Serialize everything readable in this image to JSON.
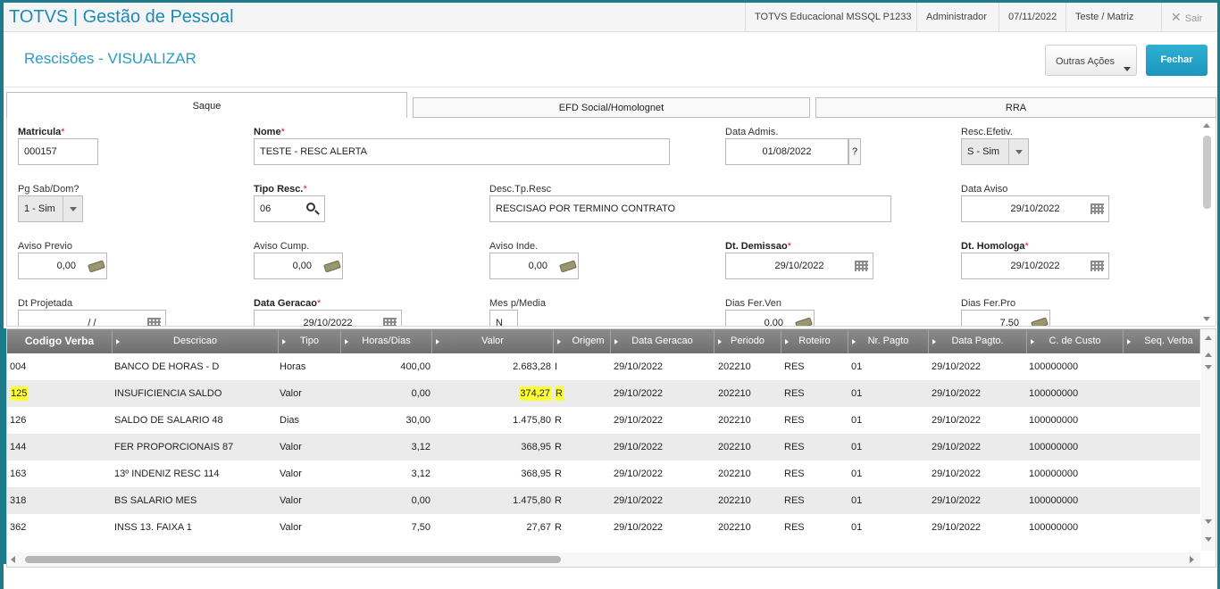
{
  "topbar": {
    "app_title": "TOTVS | Gestão de Pessoal",
    "environment": "TOTVS Educacional MSSQL P1233",
    "user": "Administrador",
    "date": "07/11/2022",
    "branch": "Teste / Matriz",
    "exit_label": "Sair"
  },
  "page": {
    "title": "Rescisões - VISUALIZAR",
    "other_actions": "Outras Ações",
    "close": "Fechar"
  },
  "tabs": [
    "Saque",
    "EFD Social/Homolognet",
    "RRA"
  ],
  "form": {
    "matricula": {
      "label": "Matricula",
      "value": "000157"
    },
    "nome": {
      "label": "Nome",
      "value": "TESTE - RESC ALERTA"
    },
    "data_admis": {
      "label": "Data Admis.",
      "value": "01/08/2022",
      "help": "?"
    },
    "resc_efetiv": {
      "label": "Resc.Efetiv.",
      "value": "S - Sim"
    },
    "pg_sab_dom": {
      "label": "Pg Sab/Dom?",
      "value": "1 - Sim"
    },
    "tipo_resc": {
      "label": "Tipo Resc.",
      "value": "06"
    },
    "desc_tp_resc": {
      "label": "Desc.Tp.Resc",
      "value": "RESCISAO POR TERMINO CONTRATO"
    },
    "data_aviso": {
      "label": "Data Aviso",
      "value": "29/10/2022"
    },
    "aviso_previo": {
      "label": "Aviso Previo",
      "value": "0,00"
    },
    "aviso_cump": {
      "label": "Aviso Cump.",
      "value": "0,00"
    },
    "aviso_inde": {
      "label": "Aviso Inde.",
      "value": "0,00"
    },
    "dt_demissao": {
      "label": "Dt. Demissao",
      "value": "29/10/2022"
    },
    "dt_homologa": {
      "label": "Dt. Homologa",
      "value": "29/10/2022"
    },
    "dt_projetada": {
      "label": "Dt Projetada",
      "value": "/  /"
    },
    "data_geracao": {
      "label": "Data Geracao",
      "value": "29/10/2022"
    },
    "mes_p_media": {
      "label": "Mes p/Media",
      "value": "N"
    },
    "dias_fer_ven": {
      "label": "Dias Fer.Ven",
      "value": "0,00"
    },
    "dias_fer_pro": {
      "label": "Dias Fer.Pro",
      "value": "7,50"
    },
    "required_mark": "*"
  },
  "grid": {
    "columns": [
      "Codigo Verba",
      "Descricao",
      "Tipo",
      "Horas/Dias",
      "Valor",
      "Origem",
      "Data Geracao",
      "Periodo",
      "Roteiro",
      "Nr. Pagto",
      "Data Pagto.",
      "C. de Custo",
      "Seq. Verba"
    ],
    "rows": [
      {
        "codigo": "004",
        "descricao": "BANCO DE HORAS - D",
        "tipo": "Horas",
        "horas": "400,00",
        "valor": "2.683,28",
        "origem": "I",
        "data_geracao": "29/10/2022",
        "periodo": "202210",
        "roteiro": "RES",
        "nr_pagto": "01",
        "data_pagto": "29/10/2022",
        "custo": "100000000"
      },
      {
        "codigo": "125",
        "descricao": "INSUFICIENCIA  SALDO",
        "tipo": "Valor",
        "horas": "0,00",
        "valor": "374,27",
        "origem": "R",
        "data_geracao": "29/10/2022",
        "periodo": "202210",
        "roteiro": "RES",
        "nr_pagto": "01",
        "data_pagto": "29/10/2022",
        "custo": "100000000"
      },
      {
        "codigo": "126",
        "descricao": "SALDO DE SALARIO 48",
        "tipo": "Dias",
        "horas": "30,00",
        "valor": "1.475,80",
        "origem": "R",
        "data_geracao": "29/10/2022",
        "periodo": "202210",
        "roteiro": "RES",
        "nr_pagto": "01",
        "data_pagto": "29/10/2022",
        "custo": "100000000"
      },
      {
        "codigo": "144",
        "descricao": "FER PROPORCIONAIS 87",
        "tipo": "Valor",
        "horas": "3,12",
        "valor": "368,95",
        "origem": "R",
        "data_geracao": "29/10/2022",
        "periodo": "202210",
        "roteiro": "RES",
        "nr_pagto": "01",
        "data_pagto": "29/10/2022",
        "custo": "100000000"
      },
      {
        "codigo": "163",
        "descricao": "13º INDENIZ RESC 114",
        "tipo": "Valor",
        "horas": "3,12",
        "valor": "368,95",
        "origem": "R",
        "data_geracao": "29/10/2022",
        "periodo": "202210",
        "roteiro": "RES",
        "nr_pagto": "01",
        "data_pagto": "29/10/2022",
        "custo": "100000000"
      },
      {
        "codigo": "318",
        "descricao": "BS SALARIO MES",
        "tipo": "Valor",
        "horas": "0,00",
        "valor": "1.475,80",
        "origem": "R",
        "data_geracao": "29/10/2022",
        "periodo": "202210",
        "roteiro": "RES",
        "nr_pagto": "01",
        "data_pagto": "29/10/2022",
        "custo": "100000000"
      },
      {
        "codigo": "362",
        "descricao": "INSS 13. FAIXA 1",
        "tipo": "Valor",
        "horas": "7,50",
        "valor": "27,67",
        "origem": "R",
        "data_geracao": "29/10/2022",
        "periodo": "202210",
        "roteiro": "RES",
        "nr_pagto": "01",
        "data_pagto": "29/10/2022",
        "custo": "100000000"
      }
    ]
  },
  "colors": {
    "brand": "#1b8cb8",
    "highlight": "#ffff38",
    "header_grid": "#7d7d7d",
    "accent_button": "#22a1c8"
  }
}
